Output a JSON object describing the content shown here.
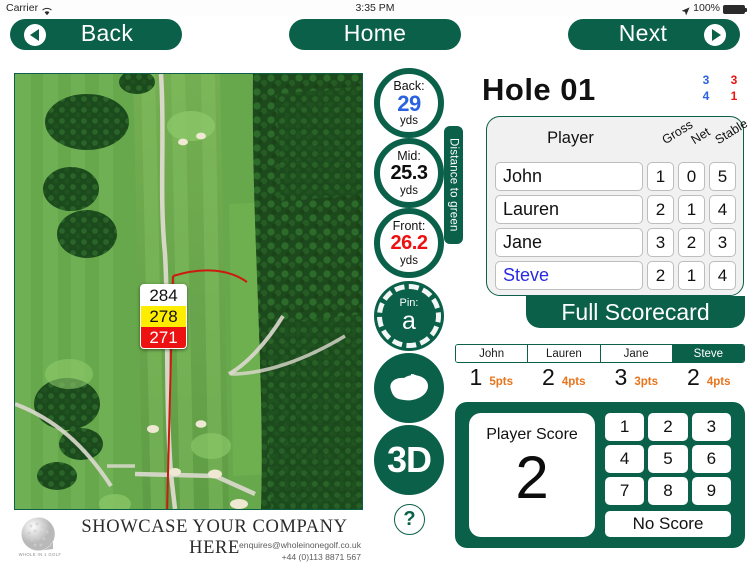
{
  "status_bar": {
    "carrier": "Carrier",
    "wifi_icon": "wifi-icon",
    "time": "3:35 PM",
    "location_icon": "location-arrow-icon",
    "battery_percent": "100%",
    "battery_icon": "battery-full-icon"
  },
  "nav": {
    "back_label": "Back",
    "back_icon": "chevron-left-circle-icon",
    "home_label": "Home",
    "next_label": "Next",
    "next_icon": "chevron-right-circle-icon"
  },
  "map": {
    "name": "aerial-hole-view",
    "distance_marker": {
      "white": "284",
      "yellow": "278",
      "red": "271"
    }
  },
  "banner": {
    "logo_icon": "golf-ball-logo",
    "logo_caption": "WHOLE IN 1 GOLF",
    "title": "SHOWCASE YOUR COMPANY HERE",
    "email": "enquires@wholeinonegolf.co.uk",
    "phone": "+44 (0)113 8871 567"
  },
  "distances": {
    "label": "Distance to green",
    "back": {
      "caption": "Back:",
      "value": "29",
      "unit": "yds",
      "color": "#2a62e0"
    },
    "mid": {
      "caption": "Mid:",
      "value": "25.3",
      "unit": "yds",
      "color": "#0d0d0d"
    },
    "front": {
      "caption": "Front:",
      "value": "26.2",
      "unit": "yds",
      "color": "#ee1111"
    },
    "pin": {
      "caption": "Pin:",
      "value": "a"
    }
  },
  "side_buttons": {
    "green_view_icon": "green-flag-icon",
    "three_d_label": "3D",
    "help_label": "?"
  },
  "hole": {
    "title": "Hole 01",
    "par_grid": [
      {
        "left": "3",
        "right": "3"
      },
      {
        "left": "4",
        "right": "1"
      }
    ],
    "par_left_color": "#2a62e0",
    "par_right_color": "#ee1111"
  },
  "scorecard": {
    "columns": [
      "Player",
      "Gross",
      "Net",
      "Stable"
    ],
    "rows": [
      {
        "player": "John",
        "gross": "1",
        "net": "0",
        "stable": "5",
        "active": false
      },
      {
        "player": "Lauren",
        "gross": "2",
        "net": "1",
        "stable": "4",
        "active": false
      },
      {
        "player": "Jane",
        "gross": "3",
        "net": "2",
        "stable": "3",
        "active": false
      },
      {
        "player": "Steve",
        "gross": "2",
        "net": "1",
        "stable": "4",
        "active": true
      }
    ],
    "full_scorecard_label": "Full Scorecard"
  },
  "player_tabs": {
    "tabs": [
      {
        "name": "John",
        "selected": false,
        "score": "1",
        "points": "5pts"
      },
      {
        "name": "Lauren",
        "selected": false,
        "score": "2",
        "points": "4pts"
      },
      {
        "name": "Jane",
        "selected": false,
        "score": "3",
        "points": "3pts"
      },
      {
        "name": "Steve",
        "selected": true,
        "score": "2",
        "points": "4pts"
      }
    ],
    "points_color": "#e8741c"
  },
  "keypad": {
    "player_score_label": "Player Score",
    "player_score_value": "2",
    "keys": [
      "1",
      "2",
      "3",
      "4",
      "5",
      "6",
      "7",
      "8",
      "9"
    ],
    "no_score_label": "No Score"
  },
  "theme": {
    "green": "#0b6049",
    "blue": "#2a62e0",
    "red": "#ee1111",
    "orange": "#e8741c"
  }
}
